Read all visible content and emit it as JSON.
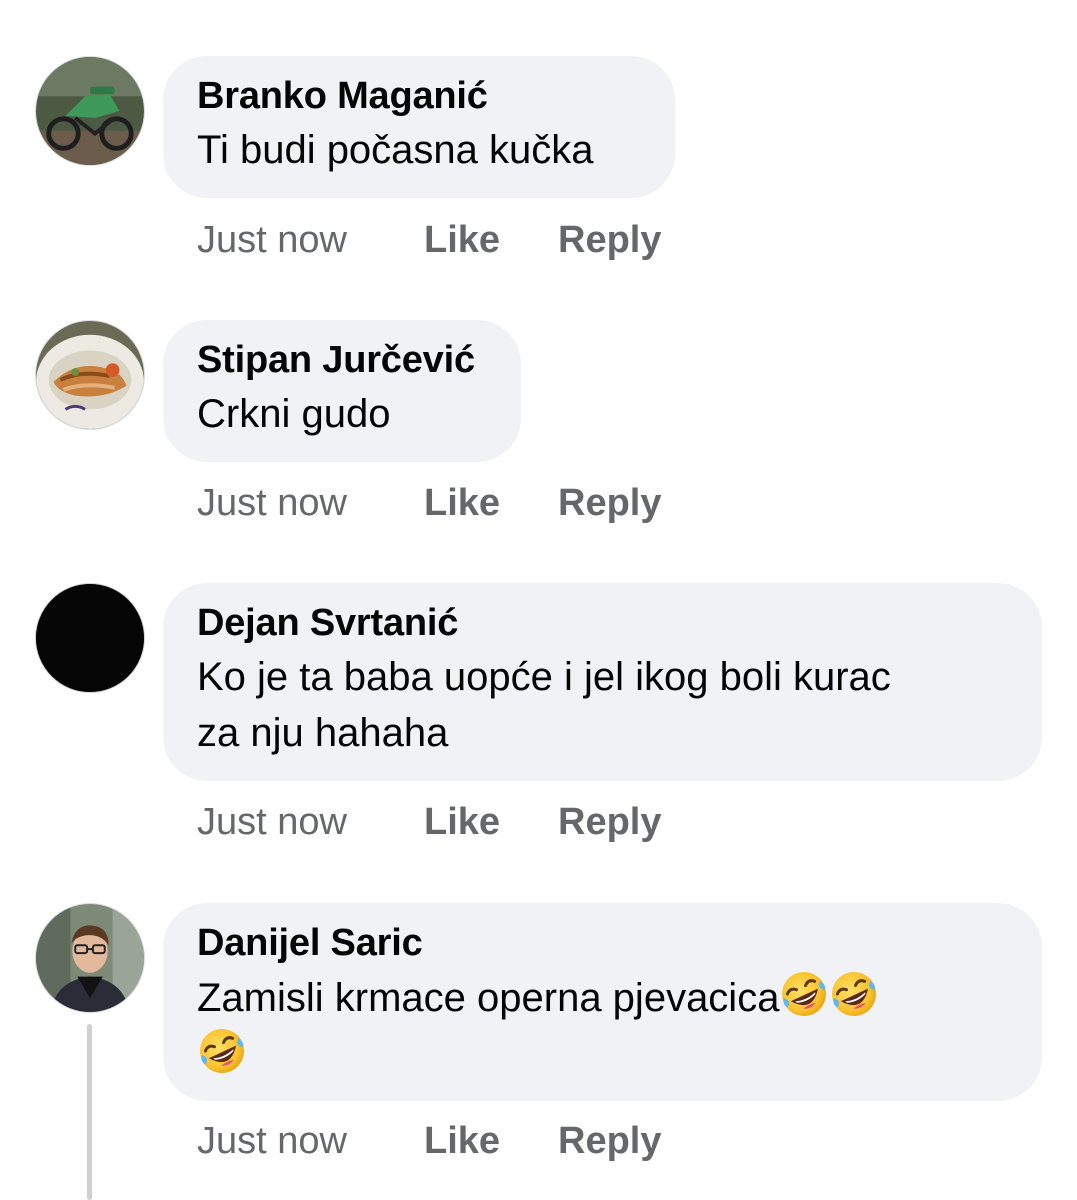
{
  "comments": [
    {
      "author": "Branko Maganić",
      "text": "Ti budi počasna kučka",
      "time": "Just now",
      "like_label": "Like",
      "reply_label": "Reply",
      "avatar": "motorcycle-photo"
    },
    {
      "author": "Stipan Jurčević",
      "text": "Crkni gudo",
      "time": "Just now",
      "like_label": "Like",
      "reply_label": "Reply",
      "avatar": "food-plate-photo"
    },
    {
      "author": "Dejan Svrtanić",
      "text_line1": "Ko je ta baba uopće i jel ikog boli kurac",
      "text_line2": "za nju hahaha",
      "time": "Just now",
      "like_label": "Like",
      "reply_label": "Reply",
      "avatar": "black-circle"
    },
    {
      "author": "Danijel Saric",
      "text": "Zamisli krmace operna pjevacica",
      "emoji": "rolling-on-the-floor-laughing",
      "time": "Just now",
      "like_label": "Like",
      "reply_label": "Reply",
      "avatar": "man-with-glasses-photo"
    }
  ],
  "colors": {
    "bubble": "#f0f2f5",
    "meta_text": "#65676b",
    "thread_line": "#ced0d4"
  }
}
